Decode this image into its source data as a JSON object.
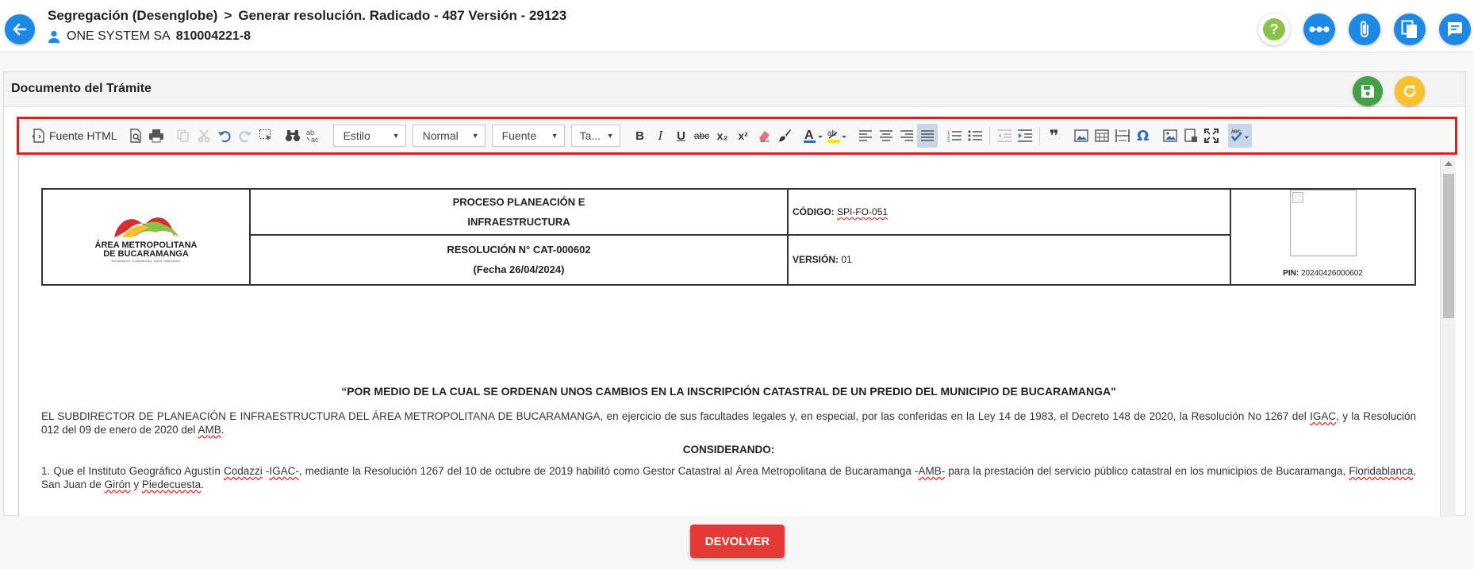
{
  "header": {
    "breadcrumb_part1": "Segregación (Desenglobe)",
    "breadcrumb_sep": ">",
    "breadcrumb_part2": "Generar resolución. Radicado - 487 Versión - 29123",
    "user_name": "ONE SYSTEM SA",
    "user_nit": "810004221-8"
  },
  "header_icons": [
    "help-icon",
    "more-icon",
    "attachment-icon",
    "copy-document-icon",
    "comments-icon"
  ],
  "panel": {
    "title": "Documento del Trámite"
  },
  "toolbar": {
    "source_label": "Fuente HTML",
    "style_combo": "Estilo",
    "format_combo": "Normal",
    "font_combo": "Fuente",
    "size_combo": "Ta...",
    "bold_glyph": "B",
    "italic_glyph": "I",
    "underline_glyph": "U",
    "strike_glyph": "abc",
    "subscript_glyph": "x₂",
    "superscript_glyph": "x²",
    "omega_glyph": "Ω",
    "quote_glyph": "❞"
  },
  "document": {
    "logo_line1": "ÁREA METROPOLITANA",
    "logo_line2": "DE BUCARAMANGA",
    "logo_tagline": "BUCARAMANGA · FLORIDABLANCA · GIRÓN · PIEDECUESTA",
    "process_line1": "PROCESO PLANEACIÓN E",
    "process_line2": "INFRAESTRUCTURA",
    "resolution_line1": "RESOLUCIÓN N° CAT-000602",
    "resolution_line2": "(Fecha 26/04/2024)",
    "code_label": "CÓDIGO:",
    "code_value": "SPI-FO-051",
    "version_label": "VERSIÓN:",
    "version_value": "01",
    "pin_label": "PIN:",
    "pin_value": "20240426000602",
    "title": "“POR MEDIO DE LA CUAL SE ORDENAN UNOS CAMBIOS EN LA INSCRIPCIÓN CATASTRAL DE UN PREDIO DEL MUNICIPIO DE BUCARAMANGA\"",
    "para1_a": "EL SUBDIRECTOR DE PLANEACIÓN E INFRAESTRUCTURA DEL ÁREA METROPOLITANA DE BUCARAMANGA, en ejercicio de sus facultades legales y, en especial, por las conferidas en la Ley 14 de 1983, el Decreto 148 de 2020, la Resolución No 1267 del ",
    "para1_igac": "IGAC",
    "para1_b": ", y la Resolución 012 del 09 de enero de 2020 del ",
    "para1_amb": "AMB",
    "para1_c": ".",
    "considerando": "CONSIDERANDO:",
    "para2_a": "1. Que el Instituto Geográfico Agustín ",
    "para2_codazzi": "Codazzi",
    "para2_b": " -",
    "para2_igac": "IGAC-",
    "para2_c": ", mediante la Resolución 1267 del 10 de octubre de 2019 habilitó como Gestor Catastral al Área Metropolitana de Bucaramanga -",
    "para2_amb": "AMB-",
    "para2_d": " para la prestación del servicio público catastral en los municipios de Bucaramanga, ",
    "para2_flor": "Floridablanca",
    "para2_e": ", San Juan de ",
    "para2_giron": "Girón",
    "para2_f": " y ",
    "para2_pied": "Piedecuesta",
    "para2_g": "."
  },
  "footer": {
    "return_button": "DEVOLVER"
  },
  "colors": {
    "primary_blue": "#1e88e5",
    "help_green": "#8bc34a",
    "save_green": "#43a047",
    "refresh_yellow": "#fbc02d",
    "toolbar_highlight": "#dc2020",
    "return_red": "#e53935"
  }
}
